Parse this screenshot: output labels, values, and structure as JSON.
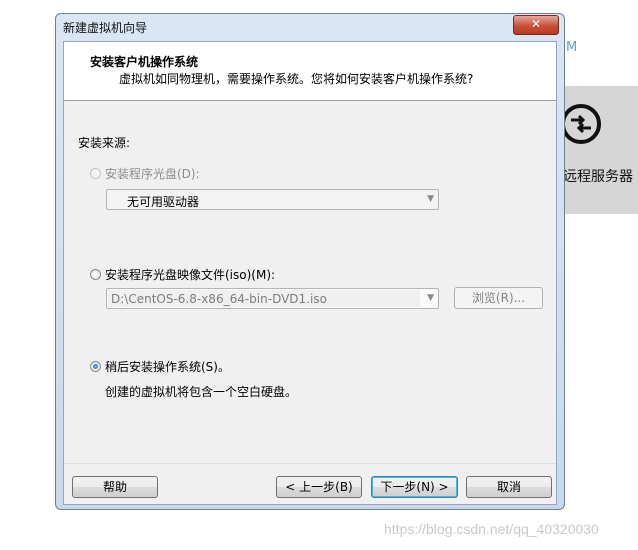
{
  "background": {
    "partial_letter": "M",
    "tile_label": "远程服务器",
    "tile_icon": "remote-server-icon",
    "watermark": "https://blog.csdn.net/qq_40320030"
  },
  "window": {
    "title": "新建虚拟机向导",
    "close_glyph": "✕"
  },
  "header": {
    "title": "安装客户机操作系统",
    "subtitle": "虚拟机如同物理机，需要操作系统。您将如何安装客户机操作系统?"
  },
  "install_source": {
    "label": "安装来源:",
    "disc_option": {
      "label": "安装程序光盘(D):",
      "selected": false,
      "enabled": false
    },
    "disc_drive": {
      "value": "无可用驱动器",
      "arrow": "▼"
    },
    "iso_option": {
      "label": "安装程序光盘映像文件(iso)(M):",
      "selected": false,
      "enabled": true
    },
    "iso_path": {
      "value": "D:\\CentOS-6.8-x86_64-bin-DVD1.iso",
      "arrow": "▼"
    },
    "browse_label": "浏览(R)...",
    "later_option": {
      "label": "稍后安装操作系统(S)。",
      "selected": true,
      "enabled": true
    },
    "later_note": "创建的虚拟机将包含一个空白硬盘。"
  },
  "footer": {
    "help": "帮助",
    "back": "< 上一步(B)",
    "next": "下一步(N) >",
    "cancel": "取消"
  }
}
